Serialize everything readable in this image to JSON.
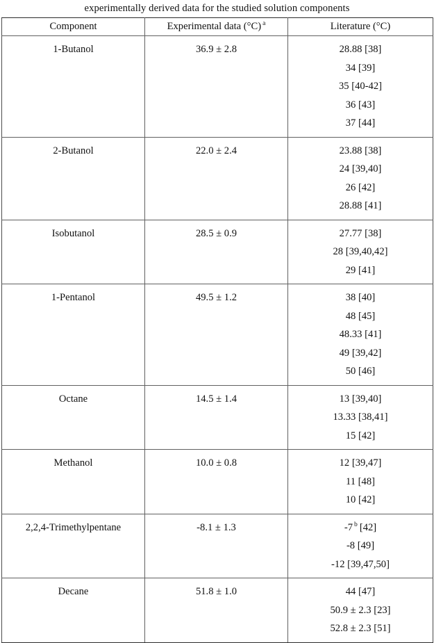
{
  "caption": "experimentally derived data for the studied solution components",
  "table": {
    "columns": [
      {
        "key": "component",
        "label": "Component",
        "sup": ""
      },
      {
        "key": "experimental",
        "label": "Experimental data (°C)",
        "sup": "a"
      },
      {
        "key": "literature",
        "label": "Literature (°C)",
        "sup": ""
      }
    ],
    "rows": [
      {
        "component": "1-Butanol",
        "experimental": "36.9 ± 2.8",
        "literature": [
          "28.88 [38]",
          "34 [39]",
          "35 [40-42]",
          "36 [43]",
          "37 [44]"
        ]
      },
      {
        "component": "2-Butanol",
        "experimental": "22.0 ± 2.4",
        "literature": [
          "23.88 [38]",
          "24 [39,40]",
          "26 [42]",
          "28.88 [41]"
        ]
      },
      {
        "component": "Isobutanol",
        "experimental": "28.5 ± 0.9",
        "literature": [
          "27.77 [38]",
          "28 [39,40,42]",
          "29 [41]"
        ]
      },
      {
        "component": "1-Pentanol",
        "experimental": "49.5 ± 1.2",
        "literature": [
          "38 [40]",
          "48 [45]",
          "48.33 [41]",
          "49 [39,42]",
          "50 [46]"
        ]
      },
      {
        "component": "Octane",
        "experimental": "14.5 ± 1.4",
        "literature": [
          "13 [39,40]",
          "13.33 [38,41]",
          "15 [42]"
        ]
      },
      {
        "component": "Methanol",
        "experimental": "10.0 ± 0.8",
        "literature": [
          "12 [39,47]",
          "11 [48]",
          "10 [42]"
        ]
      },
      {
        "component": "2,2,4-Trimethylpentane",
        "experimental": "-8.1 ± 1.3",
        "literature": [
          "-7 ᵇ [42]",
          "-8 [49]",
          "-12 [39,47,50]"
        ],
        "literature_sup": [
          {
            "text": "-7",
            "sup": "b",
            "tail": "[42]"
          },
          {
            "text": "-8 [49]",
            "sup": "",
            "tail": ""
          },
          {
            "text": "-12 [39,47,50]",
            "sup": "",
            "tail": ""
          }
        ]
      },
      {
        "component": "Decane",
        "experimental": "51.8 ± 1.0",
        "literature": [
          "44 [47]",
          "50.9 ± 2.3 [23]",
          "52.8 ± 2.3 [51]"
        ]
      }
    ]
  },
  "colors": {
    "text": "#111111",
    "rule": "#606060",
    "outer_rule": "#2b2b2b",
    "background": "#ffffff"
  }
}
